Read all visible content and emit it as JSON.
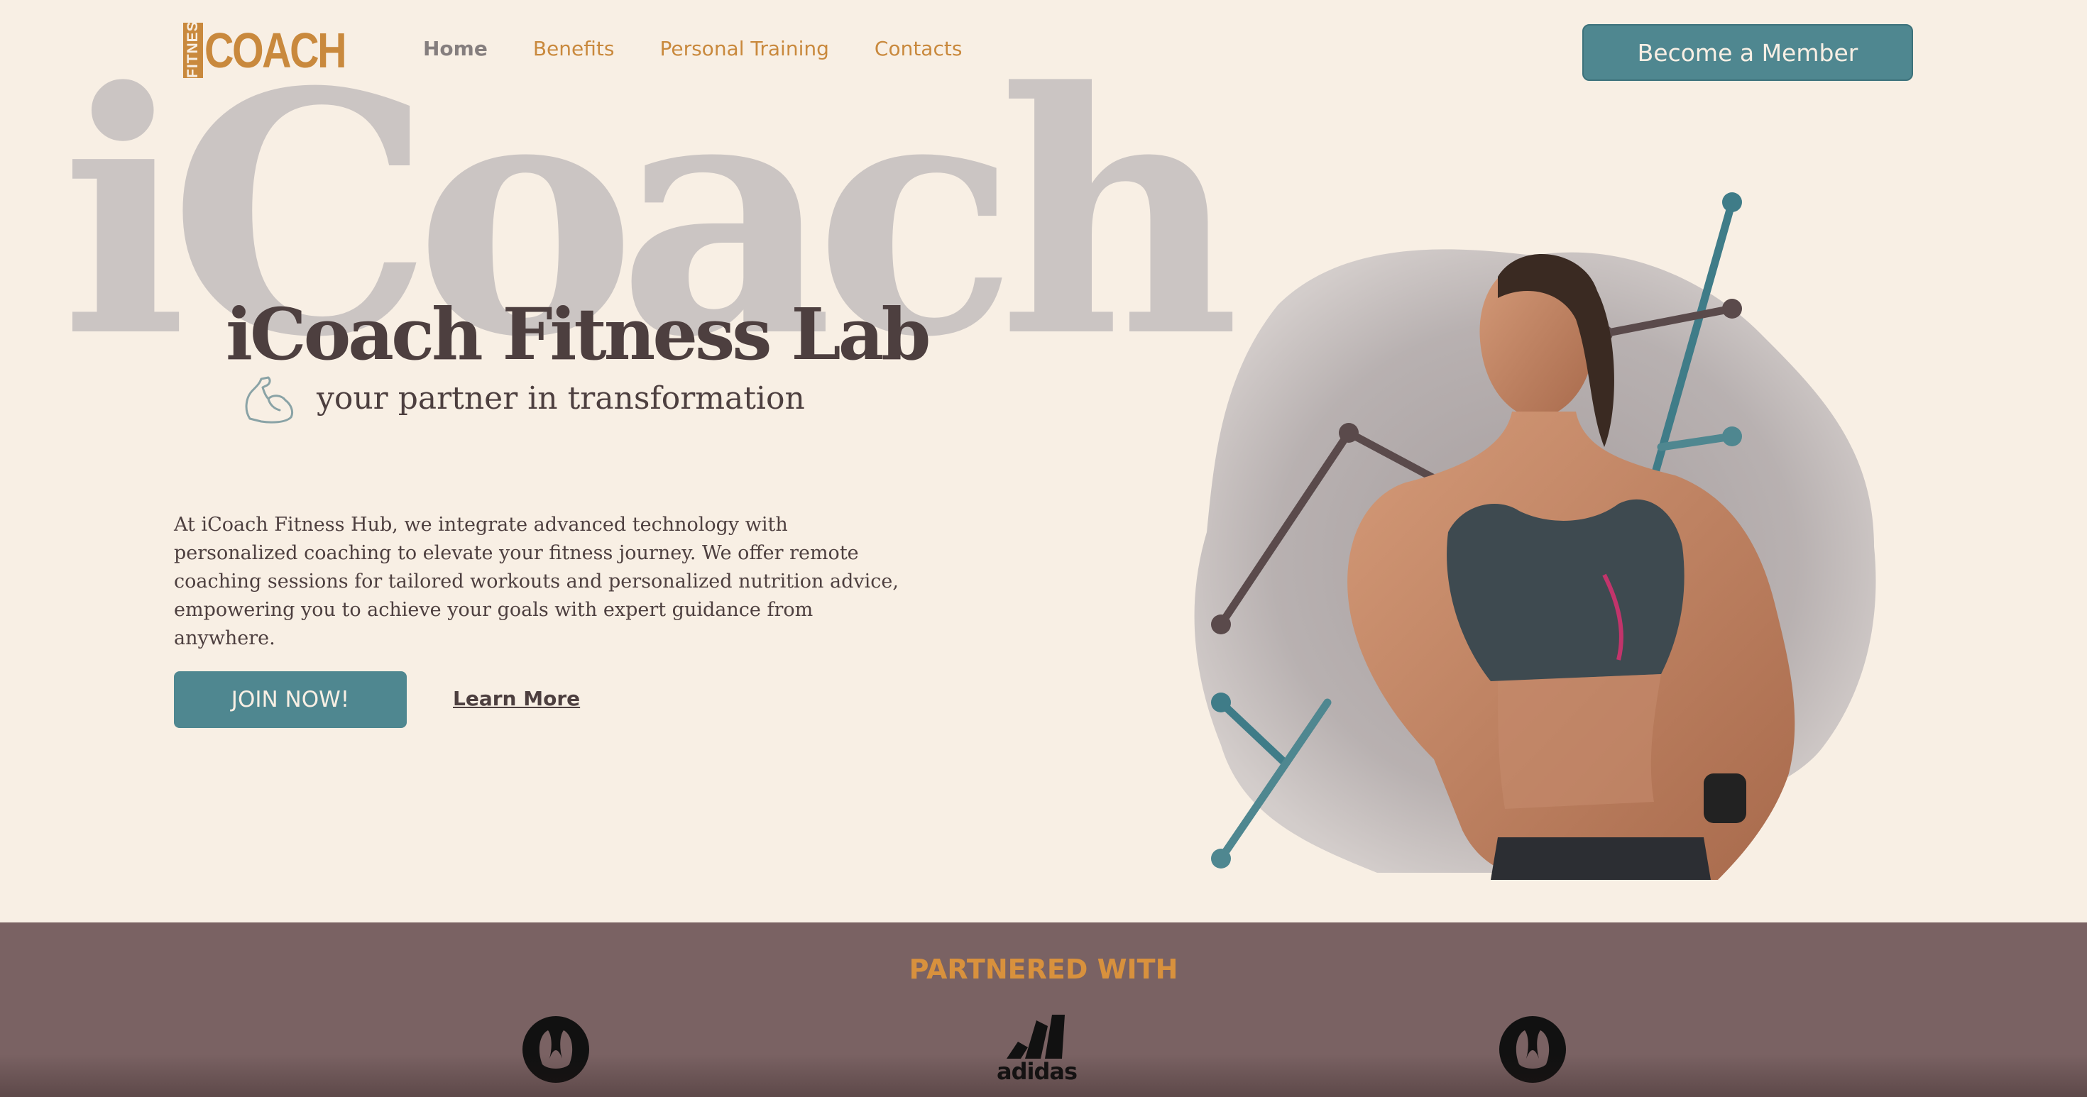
{
  "brand": {
    "logo_small": "FITNESS",
    "logo_big": "COACH",
    "accent": "#c9893d",
    "button_color": "#4f8790",
    "background": "#f8efe4",
    "partner_band": "#7a6263"
  },
  "nav": {
    "items": [
      {
        "label": "Home",
        "active": true
      },
      {
        "label": "Benefits",
        "active": false
      },
      {
        "label": "Personal Training",
        "active": false
      },
      {
        "label": "Contacts",
        "active": false
      }
    ],
    "cta_label": "Become a Member"
  },
  "hero": {
    "background_word": "iCoach",
    "title": "iCoach Fitness Lab",
    "subtitle": "your partner in transformation",
    "subtitle_icon": "flexed-arm-icon",
    "description": "At iCoach Fitness Hub, we integrate advanced technology with personalized coaching to elevate your fitness journey. We offer remote coaching sessions for tailored workouts and personalized nutrition advice, empowering you to achieve your goals with expert guidance from anywhere.",
    "join_label": "JOIN NOW!",
    "learn_more_label": "Learn More",
    "image_icon": "fitness-woman-illustration"
  },
  "partners": {
    "title": "PARTNERED WITH",
    "logos": [
      "lululemon-logo-icon",
      "adidas-logo-icon",
      "lululemon-logo-icon"
    ],
    "adidas_text": "adidas"
  }
}
